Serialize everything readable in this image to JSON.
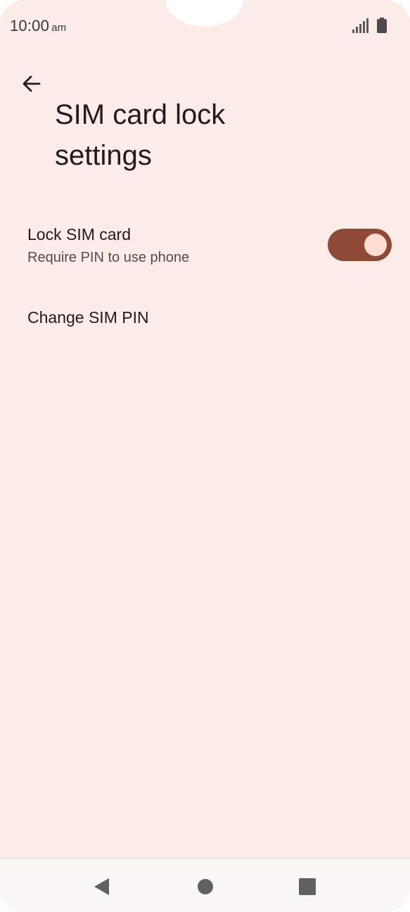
{
  "status_bar": {
    "time": "10:00",
    "ampm": "am",
    "icons": [
      "signal-icon",
      "battery-icon"
    ]
  },
  "header": {
    "back_icon": "arrow-back-icon",
    "title": "SIM card lock settings"
  },
  "preferences": {
    "lock_sim": {
      "title": "Lock SIM card",
      "summary": "Require PIN to use phone",
      "enabled": true
    },
    "change_pin": {
      "title": "Change SIM PIN"
    }
  },
  "nav_bar": {
    "icons": [
      "nav-back-icon",
      "nav-home-icon",
      "nav-recents-icon"
    ]
  },
  "colors": {
    "background": "#fbece7",
    "toggle_track": "#8f4a37",
    "toggle_thumb": "#ffdbd0",
    "text_primary": "#241a17",
    "text_secondary": "#5a4a45"
  }
}
